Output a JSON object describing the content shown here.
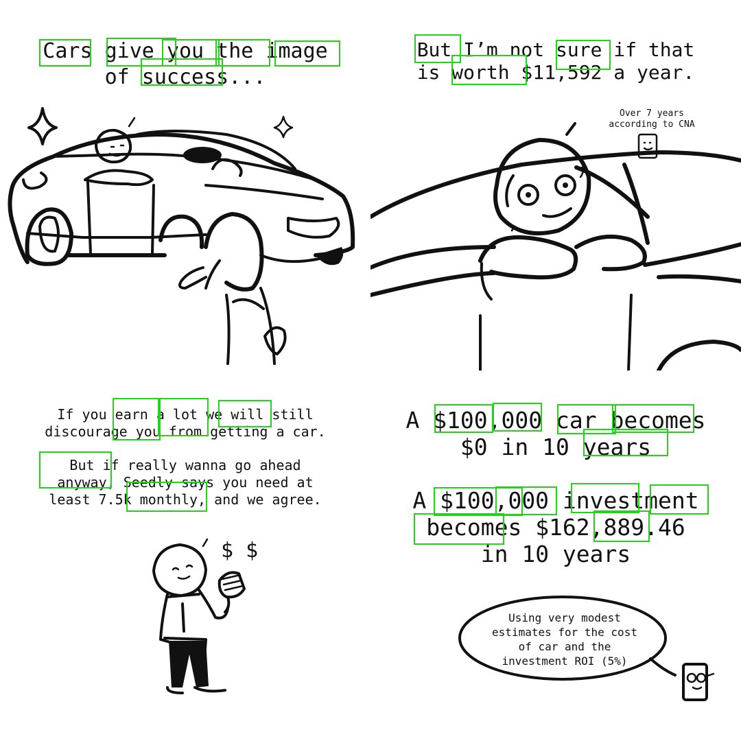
{
  "panel1": {
    "caption": "Cars give you the image\nof success..."
  },
  "panel2": {
    "caption": "But I’m not sure if that\nis worth $11,592 a year.",
    "note": "Over 7 years\naccording to CNA"
  },
  "panel3": {
    "caption_1": "If you earn a lot we will still\ndiscourage you from getting a car.",
    "caption_2": "But if really wanna go ahead\nanyway, Seedly says you need at\nleast 7.5k monthly, and we agree.",
    "dollar_signs": "$ $"
  },
  "panel4": {
    "caption_1": "A $100,000 car becomes\n$0 in 10 years",
    "caption_2": "A $100,000 investment\nbecomes $162,889.46\nin 10 years",
    "bubble": "Using very modest\nestimates for the cost\nof car and the\ninvestment ROI (5%)"
  },
  "colors": {
    "ink": "#111111",
    "highlight": "#22d416",
    "background": "#ffffff"
  }
}
